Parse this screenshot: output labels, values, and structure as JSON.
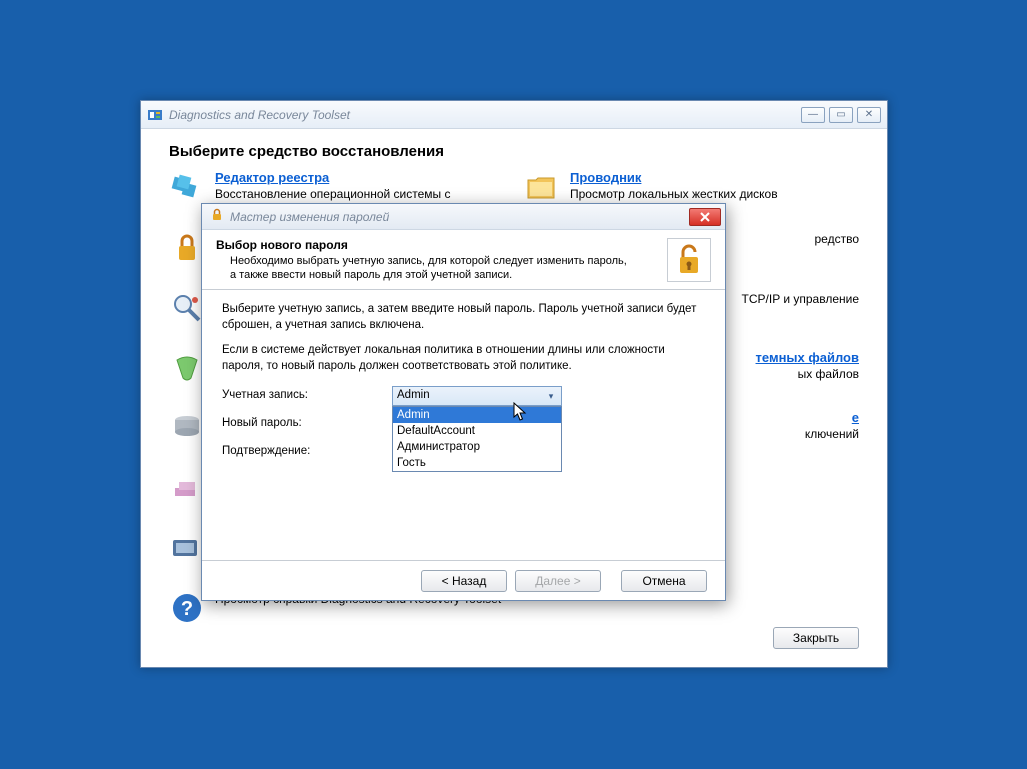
{
  "mainWindow": {
    "title": "Diagnostics and Recovery Toolset",
    "heading": "Выберите средство восстановления",
    "closeBtn": "Закрыть"
  },
  "tools": {
    "registry": {
      "title": "Редактор реестра",
      "desc": "Восстановление операционной системы с"
    },
    "explorer": {
      "title": "Проводник",
      "desc": "Просмотр локальных жестких дисков"
    },
    "locksmith": {
      "title": "",
      "desc": ""
    },
    "crash": {
      "title": "",
      "desc": "редство"
    },
    "diskcmd": {
      "title": "",
      "desc": ""
    },
    "tcp": {
      "title": "",
      "desc": "TCP/IP и управление"
    },
    "disk": {
      "title": "",
      "desc": ""
    },
    "sfc": {
      "title": "темных файлов",
      "desc": "ых файлов"
    },
    "wipe": {
      "title": "",
      "desc": ""
    },
    "comp": {
      "title": "е",
      "desc": "ключений"
    },
    "help": {
      "title": "",
      "desc": "Просмотр справки Diagnostics and Recovery Toolset"
    }
  },
  "wizard": {
    "title": "Мастер изменения паролей",
    "header": {
      "title": "Выбор нового пароля",
      "desc": "Необходимо выбрать учетную запись, для которой следует изменить пароль, а также ввести новый пароль для этой учетной записи."
    },
    "body": {
      "p1": "Выберите учетную запись, а затем введите новый пароль. Пароль учетной записи будет сброшен, а учетная запись включена.",
      "p2": "Если в системе действует локальная политика в отношении длины или сложности пароля, то новый пароль должен соответствовать этой политике.",
      "labelAccount": "Учетная запись:",
      "labelNewPass": "Новый пароль:",
      "labelConfirm": "Подтверждение:"
    },
    "account": {
      "selected": "Admin",
      "options": [
        "Admin",
        "DefaultAccount",
        "Администратор",
        "Гость"
      ]
    },
    "buttons": {
      "back": "< Назад",
      "next": "Далее >",
      "cancel": "Отмена"
    }
  }
}
